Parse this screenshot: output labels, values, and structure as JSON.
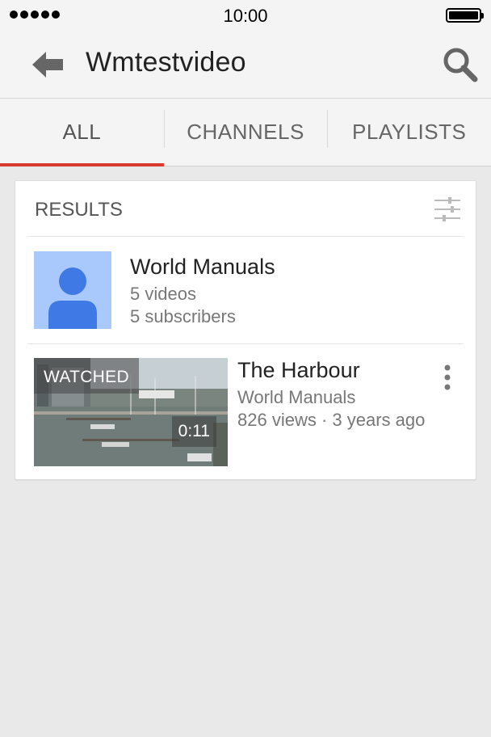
{
  "status_bar": {
    "time": "10:00"
  },
  "app_bar": {
    "title": "Wmtestvideo",
    "back_icon": "back-arrow-icon",
    "search_icon": "search-icon"
  },
  "tabs": [
    {
      "label": "ALL",
      "active": true
    },
    {
      "label": "CHANNELS",
      "active": false
    },
    {
      "label": "PLAYLISTS",
      "active": false
    }
  ],
  "results": {
    "title": "RESULTS",
    "filter_icon": "filter-sliders-icon",
    "channel": {
      "name": "World Manuals",
      "videos": "5 videos",
      "subscribers": "5 subscribers"
    },
    "video": {
      "title": "The Harbour",
      "channel": "World Manuals",
      "meta": "826 views · 3 years ago",
      "watched_label": "WATCHED",
      "duration": "0:11",
      "more_icon": "more-vertical-icon"
    }
  },
  "colors": {
    "accent": "#d83a2f",
    "avatar_bg": "#a9c8fb",
    "avatar_fg": "#3e79e5"
  }
}
